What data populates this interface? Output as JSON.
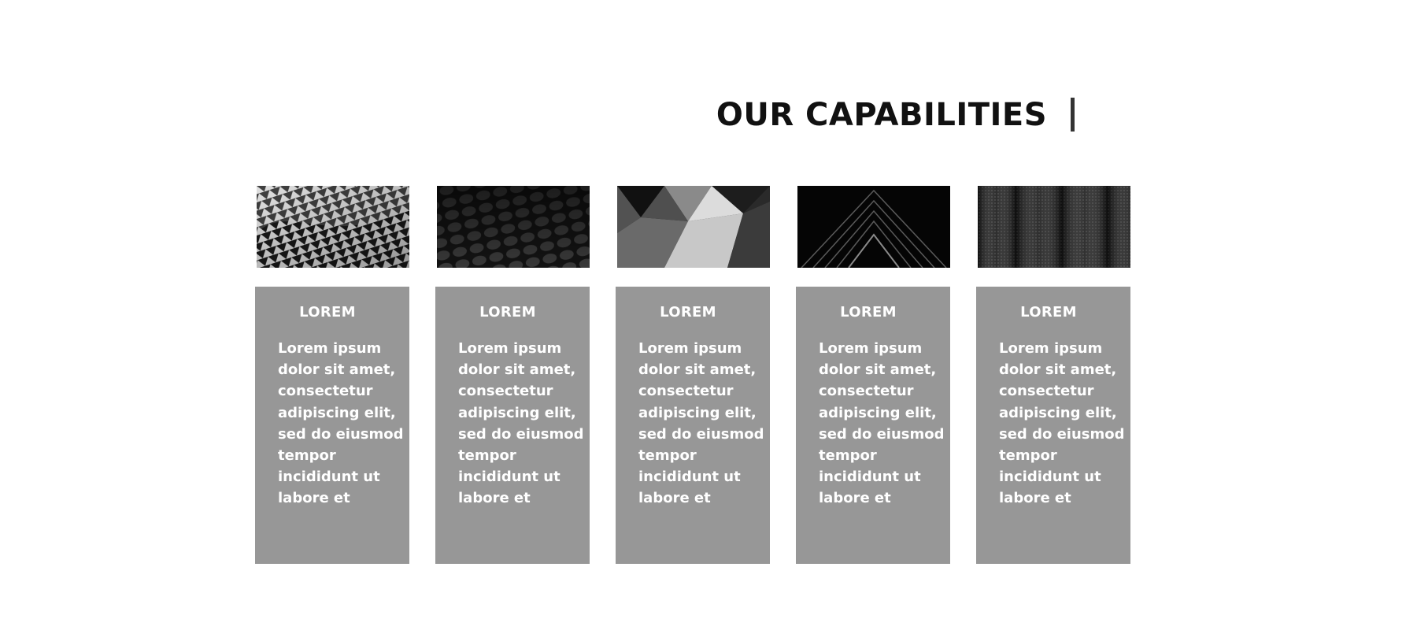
{
  "slide": {
    "title": "OUR CAPABILITIES"
  },
  "cards": [
    {
      "heading": "LOREM",
      "body": "Lorem ipsum dolor sit amet, consectetur adipiscing elit, sed do eiusmod tempor incididunt ut labore et",
      "image": "wavy-metallic-facade-photo"
    },
    {
      "heading": "LOREM",
      "body": "Lorem ipsum dolor sit amet, consectetur adipiscing elit, sed do eiusmod tempor incididunt ut labore et",
      "image": "dark-circular-tiles-photo"
    },
    {
      "heading": "LOREM",
      "body": "Lorem ipsum dolor sit amet, consectetur adipiscing elit, sed do eiusmod tempor incididunt ut labore et",
      "image": "faceted-geometric-ceiling-photo"
    },
    {
      "heading": "LOREM",
      "body": "Lorem ipsum dolor sit amet, consectetur adipiscing elit, sed do eiusmod tempor incididunt ut labore et",
      "image": "dark-chevron-lines-photo"
    },
    {
      "heading": "LOREM",
      "body": "Lorem ipsum dolor sit amet, consectetur adipiscing elit, sed do eiusmod tempor incididunt ut labore et",
      "image": "dark-mesh-panels-photo"
    }
  ],
  "colors": {
    "card_background": "#979797",
    "card_text": "#ffffff",
    "title_text": "#111111",
    "title_accent_bar": "#333333"
  }
}
